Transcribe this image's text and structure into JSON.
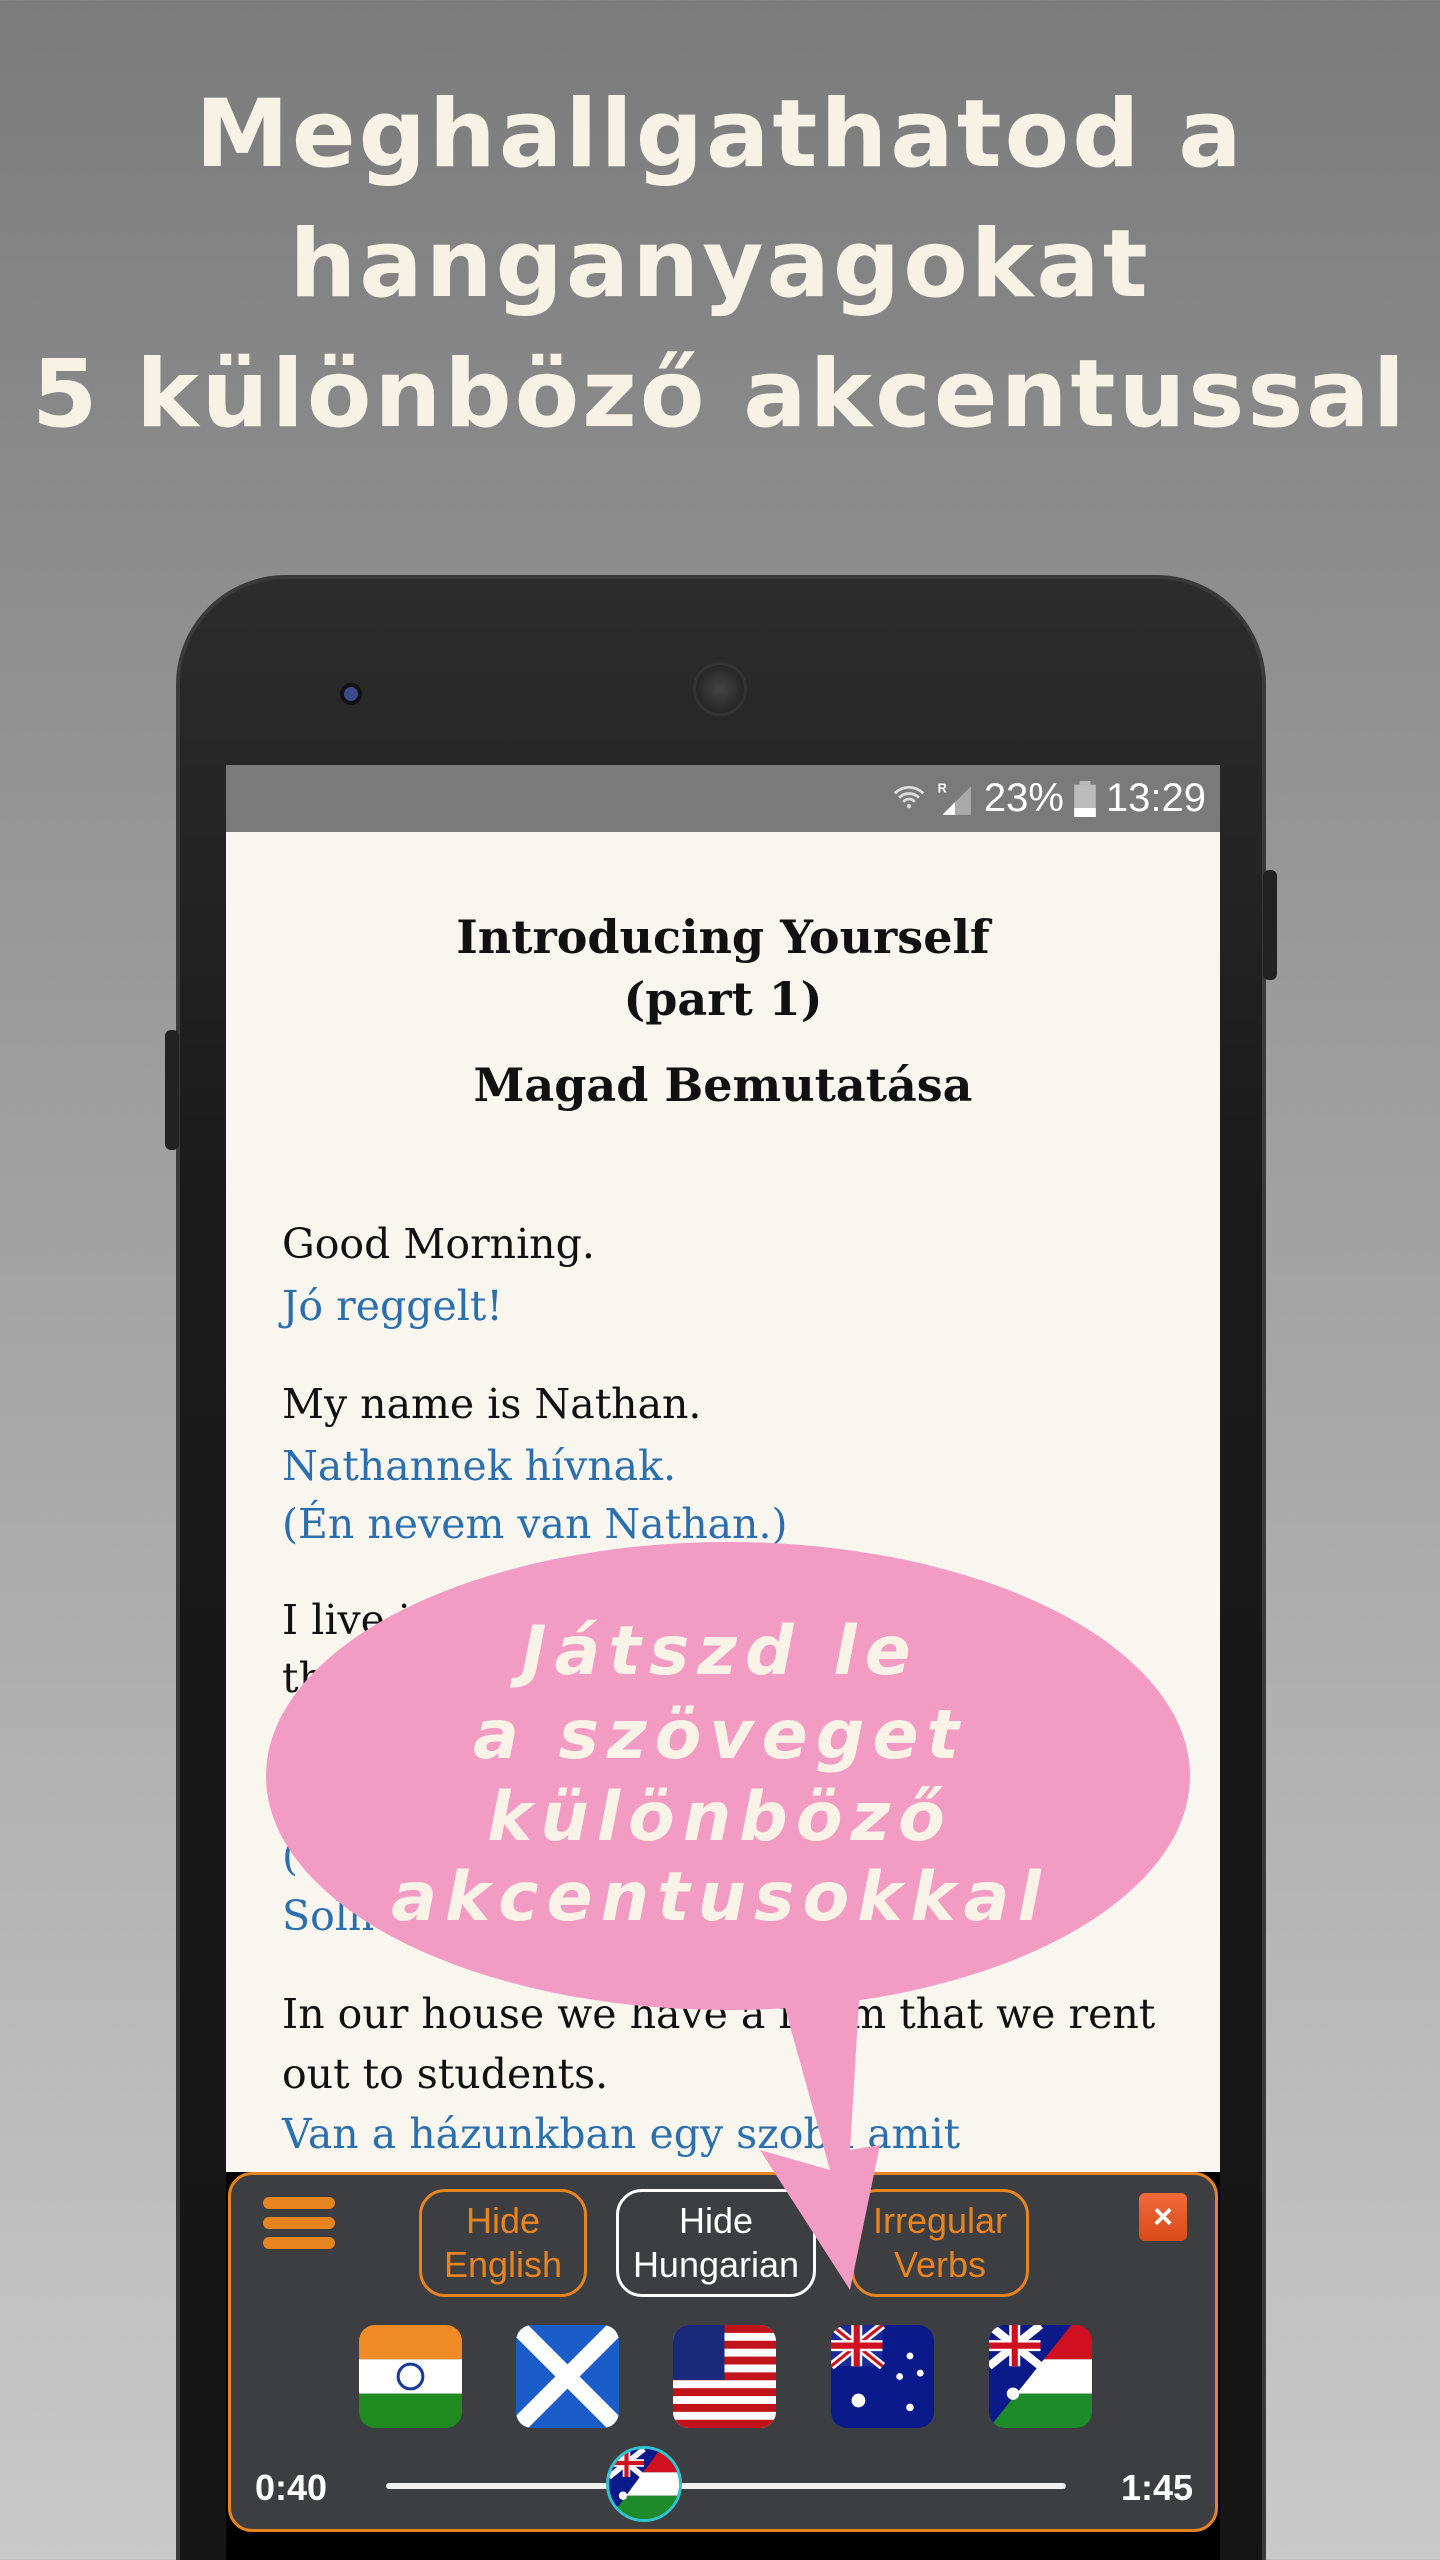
{
  "headline": [
    "Meghallgathatod a",
    "hanganyagokat",
    "5 különböző akcentussal"
  ],
  "status_bar": {
    "battery": "23%",
    "time": "13:29",
    "icons": [
      "wifi-icon",
      "signal-roaming-icon",
      "battery-icon"
    ]
  },
  "lesson": {
    "title_line1": "Introducing Yourself",
    "title_line2": "(part 1)",
    "subtitle": "Magad Bemutatása",
    "lines": [
      {
        "lang": "en",
        "text": "Good Morning."
      },
      {
        "lang": "hu",
        "text": "Jó reggelt!"
      },
      {
        "lang": "en",
        "text": "My name is Nathan."
      },
      {
        "lang": "hu",
        "text": "Nathannek hívnak."
      },
      {
        "lang": "hu",
        "text": "(Én nevem van Nathan.)"
      },
      {
        "lang": "en",
        "text": "I live in"
      },
      {
        "lang": "en",
        "text": "the"
      },
      {
        "lang": "hu",
        "text": "("
      },
      {
        "lang": "hu",
        "text": "Soln"
      },
      {
        "lang": "en",
        "text": "In our house we have a room that we rent"
      },
      {
        "lang": "en",
        "text": "out to students."
      },
      {
        "lang": "hu",
        "text": "Van a házunkban egy szoba amit"
      }
    ]
  },
  "callout": {
    "lines": [
      "Játszd le",
      "a szöveget",
      "különböző",
      "akcentusokkal"
    ],
    "color": "#f29bc3"
  },
  "controls": {
    "hide_english": [
      "Hide",
      "English"
    ],
    "hide_hungarian": [
      "Hide",
      "Hungarian"
    ],
    "irregular_verbs": [
      "Irregular",
      "Verbs"
    ],
    "close": "×",
    "accents": [
      "india",
      "scotland",
      "usa",
      "australia",
      "australia-hungary"
    ],
    "selected_accent": "australia-hungary",
    "current_time": "0:40",
    "total_time": "1:45",
    "progress": 0.38
  },
  "colors": {
    "accent": "#e8841f",
    "english_text": "#111111",
    "hungarian_text": "#2b6fae",
    "panel": "#3c3e41"
  }
}
